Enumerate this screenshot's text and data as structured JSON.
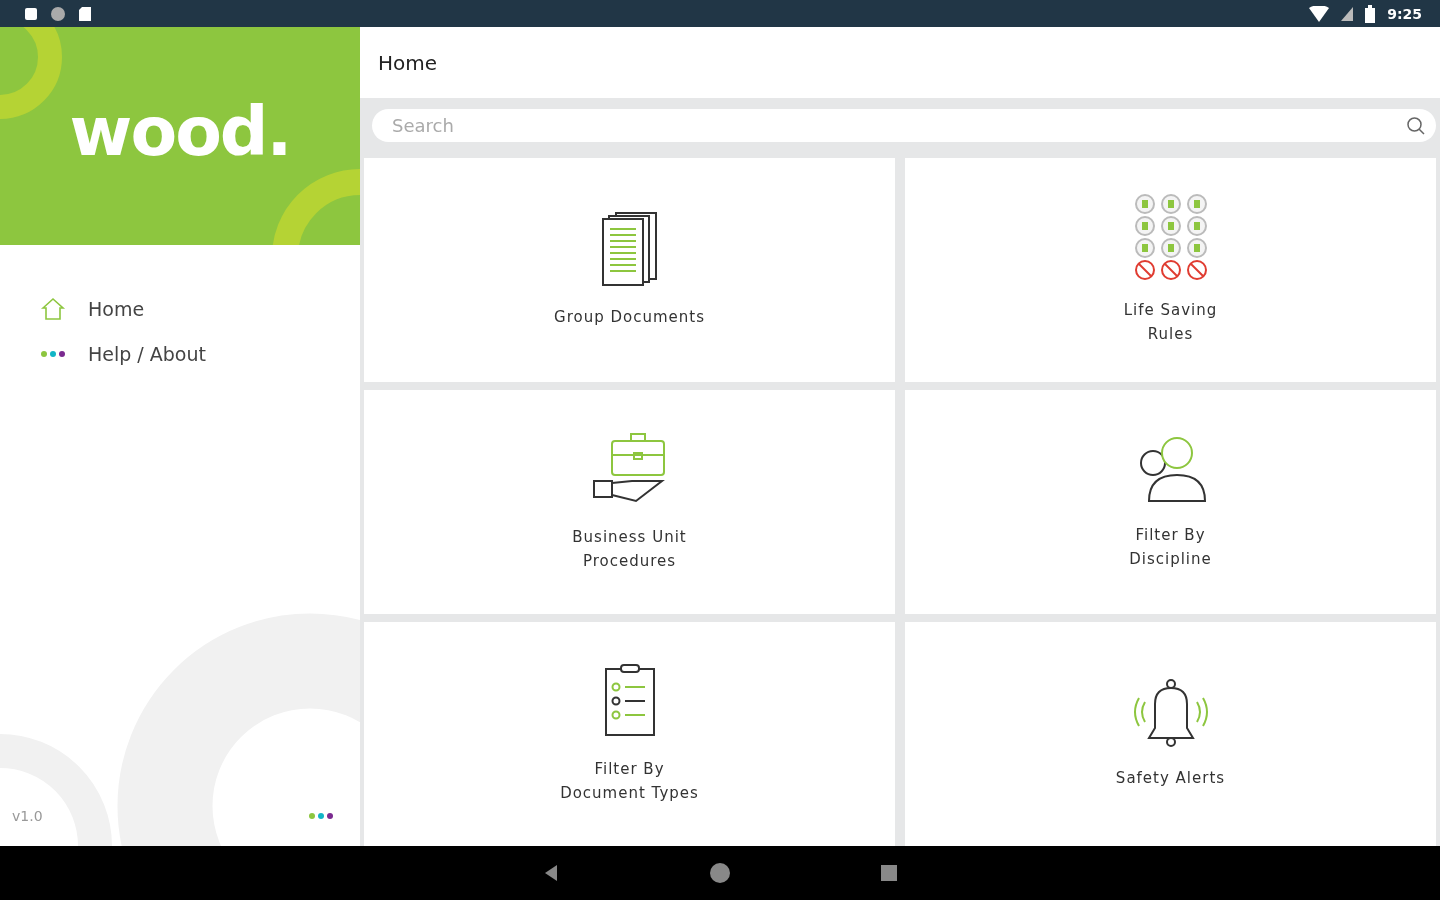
{
  "status_bar": {
    "time": "9:25"
  },
  "sidebar": {
    "logo": "wood.",
    "items": [
      {
        "kind": "home",
        "label": "Home"
      },
      {
        "kind": "dots",
        "label": "Help / About"
      }
    ],
    "version": "v1.0"
  },
  "header": {
    "title": "Home"
  },
  "search": {
    "placeholder": "Search"
  },
  "tiles": [
    {
      "kind": "documents",
      "lines": [
        "Group Documents"
      ]
    },
    {
      "kind": "rules",
      "lines": [
        "Life Saving",
        "Rules"
      ]
    },
    {
      "kind": "briefcase",
      "lines": [
        "Business Unit",
        "Procedures"
      ]
    },
    {
      "kind": "discipline",
      "lines": [
        "Filter By",
        "Discipline"
      ]
    },
    {
      "kind": "clipboard",
      "lines": [
        "Filter By",
        "Document Types"
      ]
    },
    {
      "kind": "bell",
      "lines": [
        "Safety Alerts"
      ]
    }
  ]
}
